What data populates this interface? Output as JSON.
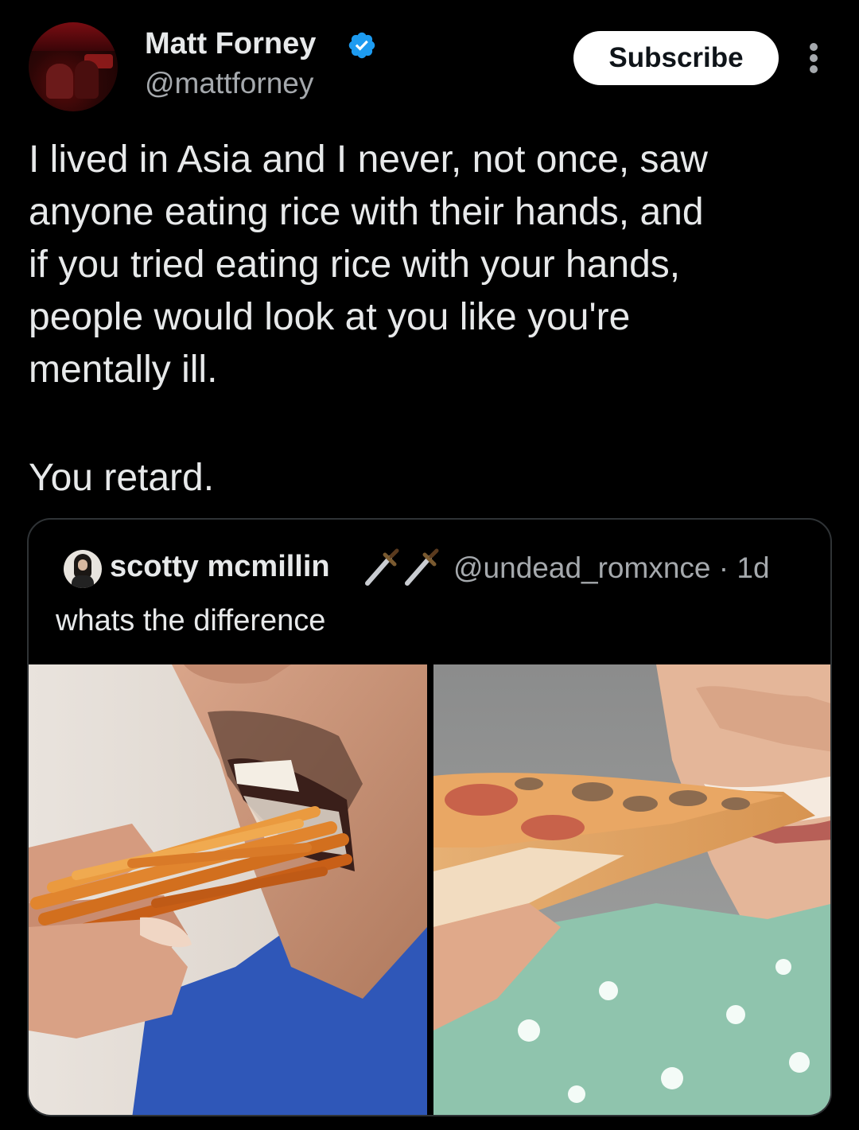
{
  "author": {
    "display_name": "Matt Forney",
    "handle": "@mattforney",
    "verified": true
  },
  "actions": {
    "subscribe_label": "Subscribe"
  },
  "tweet": {
    "text": "I lived in Asia and I never, not once, saw\nanyone eating rice with their hands, and\nif you tried eating rice with your hands,\npeople would look at you like you're\nmentally ill.",
    "text_2": "You retard."
  },
  "quoted_tweet": {
    "display_name": "scotty mcmillin",
    "name_emojis": [
      "dagger-emoji",
      "dagger-emoji"
    ],
    "handle_time": "@undead_romxnce · 1d",
    "text": "whats the difference",
    "images": [
      {
        "icon": "man-eating-noodles-photo"
      },
      {
        "icon": "woman-eating-pizza-photo"
      }
    ]
  },
  "colors": {
    "background": "#000000",
    "text": "#e7e9ea",
    "secondary_text": "#a5a9ad",
    "verified_badge": "#1d9bf0",
    "border": "#2f3336"
  }
}
